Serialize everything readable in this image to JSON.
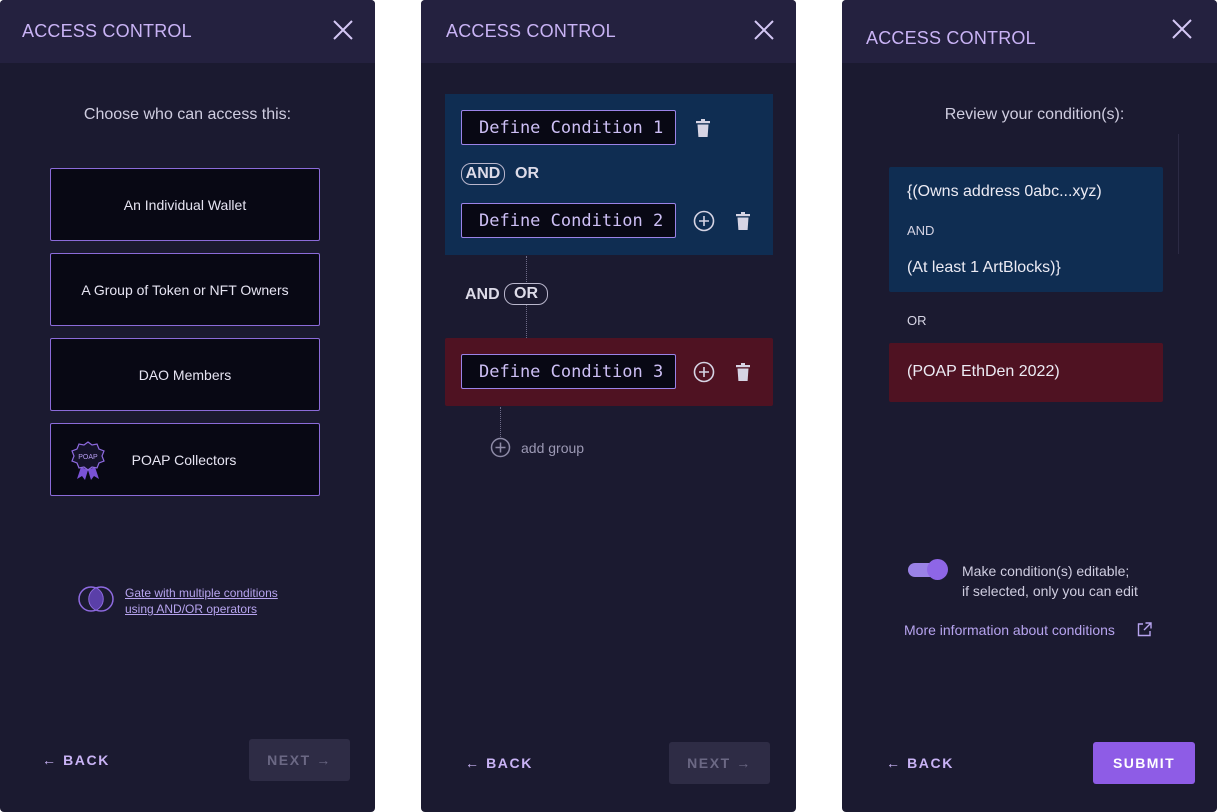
{
  "panel1": {
    "title": "ACCESS CONTROL",
    "heading": "Choose who can access this:",
    "options": [
      {
        "label": "An Individual Wallet"
      },
      {
        "label": "A Group of Token or NFT Owners"
      },
      {
        "label": "DAO Members"
      },
      {
        "label": "POAP Collectors",
        "icon": "poap-badge-icon",
        "icon_text": "POAP"
      }
    ],
    "multi_link": {
      "line1": "Gate with multiple conditions",
      "line2": "using AND/OR operators"
    },
    "back_label": "← BACK",
    "next_label": "NEXT →"
  },
  "panel2": {
    "title": "ACCESS CONTROL",
    "group1": {
      "color": "#0f2d52",
      "conditions": [
        "Define Condition 1",
        "Define Condition 2"
      ],
      "op_selected": "AND",
      "op_other": "OR"
    },
    "between_groups": {
      "op_plain": "AND",
      "op_selected": "OR"
    },
    "group2": {
      "color": "#4f1222",
      "conditions": [
        "Define Condition 3"
      ]
    },
    "add_group_label": "add group",
    "back_label": "← BACK",
    "next_label": "NEXT →"
  },
  "panel3": {
    "title": "ACCESS CONTROL",
    "heading": "Review your condition(s):",
    "group1": {
      "color": "#0f2d52",
      "line1": "{(Owns address 0abc...xyz)",
      "op": "AND",
      "line2": "(At least 1 ArtBlocks)}"
    },
    "between_op": "OR",
    "group2": {
      "color": "#4f1222",
      "line1": "(POAP EthDen 2022)"
    },
    "toggle": {
      "on": true,
      "line1": "Make condition(s) editable;",
      "line2": "if selected, only you can edit"
    },
    "more_info_label": "More information about conditions",
    "back_label": "← BACK",
    "submit_label": "SUBMIT"
  },
  "colors": {
    "accent": "#8e5ce6",
    "panel_bg": "#1b1a30",
    "header_bg": "#24213f"
  }
}
